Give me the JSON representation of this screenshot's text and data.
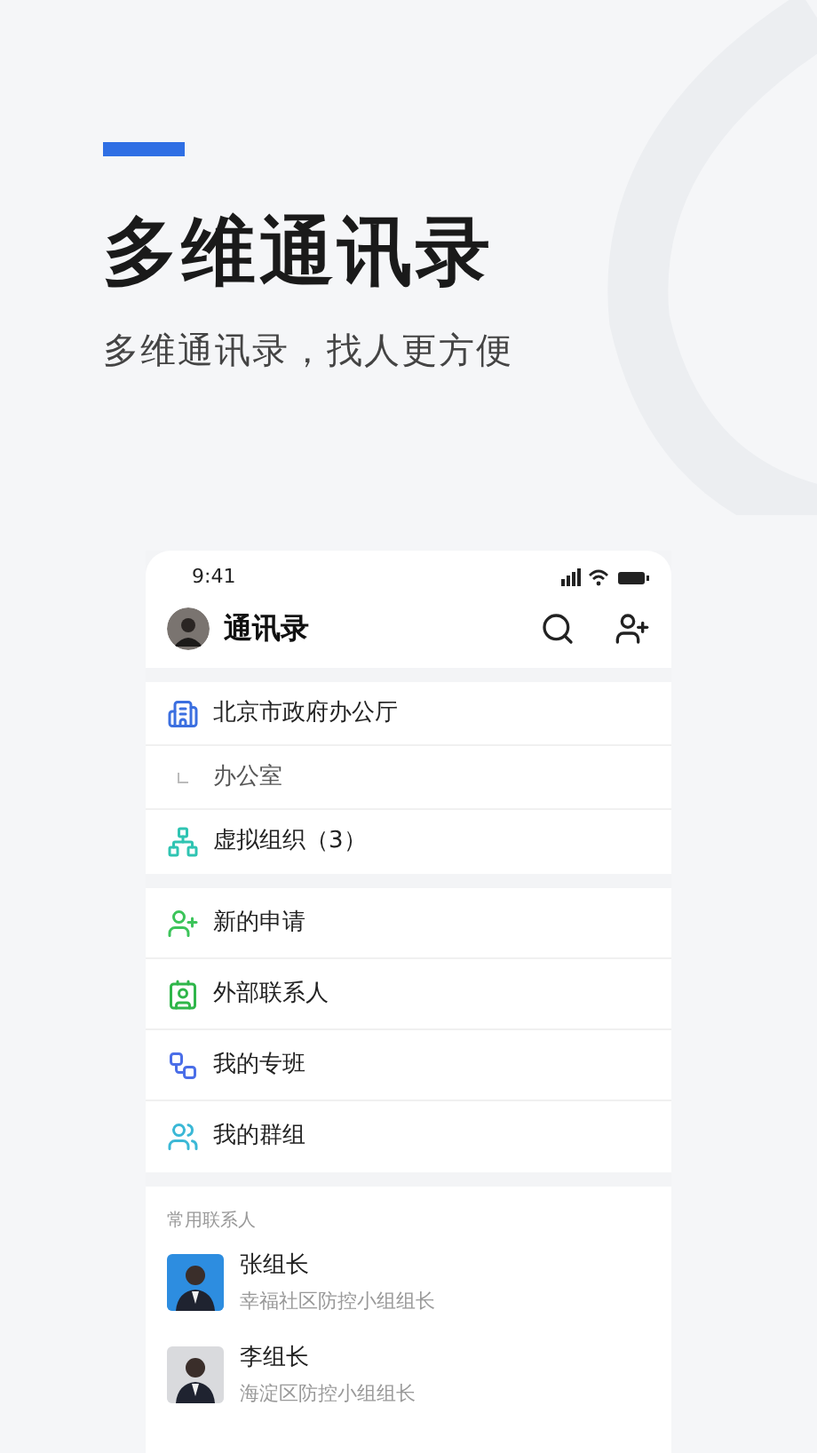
{
  "hero": {
    "title": "多维通讯录",
    "subtitle": "多维通讯录，找人更方便"
  },
  "phone": {
    "status_bar": {
      "time": "9:41"
    },
    "header": {
      "title": "通讯录"
    },
    "org_items": [
      {
        "kind": "building",
        "label": "北京市政府办公厅"
      },
      {
        "kind": "sub",
        "label": "办公室"
      },
      {
        "kind": "network",
        "label": "虚拟组织（3）"
      }
    ],
    "menu_items": [
      {
        "kind": "add-user",
        "label": "新的申请"
      },
      {
        "kind": "contact",
        "label": "外部联系人"
      },
      {
        "kind": "circle",
        "label": "我的专班"
      },
      {
        "kind": "group",
        "label": "我的群组"
      }
    ],
    "frequent": {
      "heading": "常用联系人",
      "contacts": [
        {
          "name": "张组长",
          "role": "幸福社区防控小组组长",
          "kind": "picture",
          "color": "#2d8de0"
        },
        {
          "name": "李组长",
          "role": "海淀区防控小组组长",
          "kind": "picture",
          "color": "#d9dadd"
        }
      ]
    }
  }
}
